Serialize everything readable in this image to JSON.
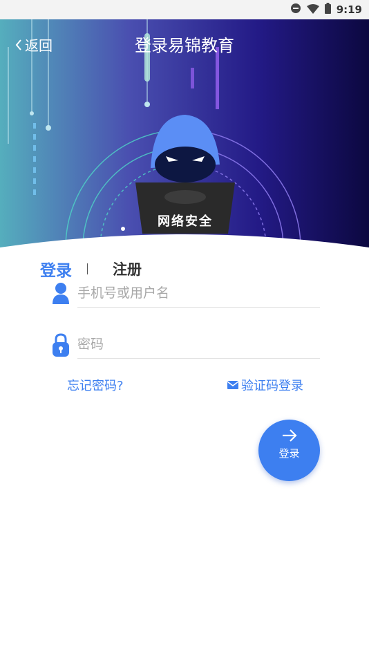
{
  "status_bar": {
    "time": "9:19"
  },
  "header": {
    "back_label": "返回",
    "title": "登录易锦教育",
    "banner_text": "网络安全"
  },
  "tabs": {
    "login": "登录",
    "register": "注册"
  },
  "form": {
    "username_placeholder": "手机号或用户名",
    "password_placeholder": "密码"
  },
  "links": {
    "forgot": "忘记密码?",
    "sms_login": "验证码登录"
  },
  "submit": {
    "label": "登录"
  },
  "colors": {
    "accent": "#3d7ff0"
  }
}
